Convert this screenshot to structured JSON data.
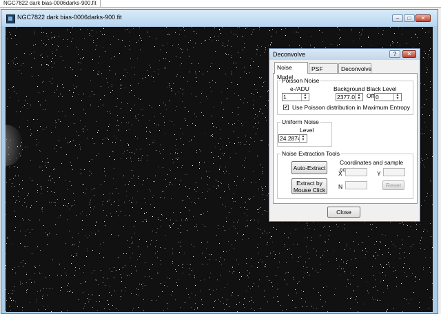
{
  "tab": {
    "label": "NGC7822 dark bias-0006darks-900.fit"
  },
  "window": {
    "title": "NGC7822 dark bias-0006darks-900.fit",
    "minimize_glyph": "–",
    "maximize_glyph": "□",
    "close_glyph": "✕"
  },
  "dialog": {
    "title": "Deconvolve",
    "help_glyph": "?",
    "close_glyph": "✕",
    "tabs": [
      "Noise Model",
      "PSF Model",
      "Deconvolve"
    ],
    "poisson": {
      "title": "Poisson Noise",
      "eadu_label": "e-/ADU",
      "eadu_value": "1",
      "background_label": "Background",
      "background_value": "2377.03",
      "black_label": "Black Level Offset",
      "black_value": "0",
      "use_poisson_label": "Use Poisson distribution in Maximum Entropy"
    },
    "uniform": {
      "title": "Uniform Noise",
      "level_label": "Level",
      "level_value": "24.2874"
    },
    "extraction": {
      "title": "Noise Extraction Tools",
      "auto_extract": "Auto-Extract",
      "extract_mouse_line1": "Extract by",
      "extract_mouse_line2": "Mouse Click",
      "coords_label": "Coordinates and sample count",
      "x_label": "X",
      "y_label": "Y",
      "n_label": "N",
      "reset": "Reset"
    },
    "close_button": "Close"
  }
}
